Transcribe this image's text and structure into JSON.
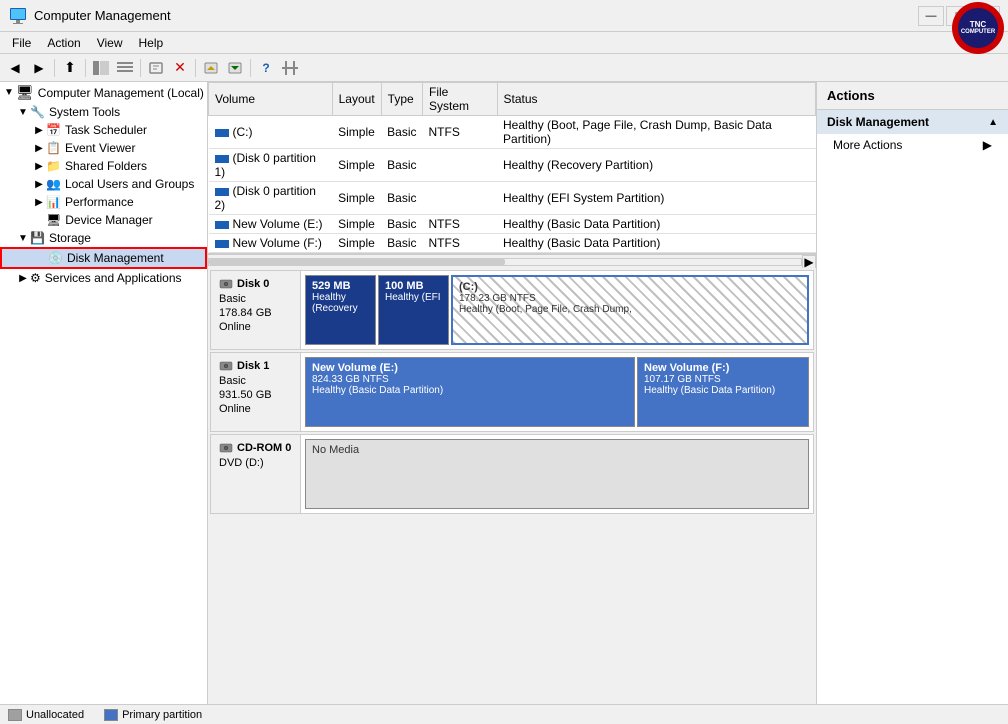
{
  "window": {
    "title": "Computer Management",
    "controls": {
      "minimize": "—",
      "maximize": "□",
      "close": "✕"
    }
  },
  "tnc": {
    "line1": "TNC",
    "line2": "COMPUTER"
  },
  "menubar": {
    "items": [
      "File",
      "Action",
      "View",
      "Help"
    ]
  },
  "toolbar": {
    "buttons": [
      "◀",
      "▶",
      "⬆",
      "🖥",
      "📄",
      "⬛",
      "📋",
      "🚫",
      "📤",
      "📥",
      "🔧"
    ]
  },
  "sidebar": {
    "root": {
      "label": "Computer Management (Local)",
      "children": [
        {
          "label": "System Tools",
          "expanded": true,
          "children": [
            {
              "label": "Task Scheduler"
            },
            {
              "label": "Event Viewer"
            },
            {
              "label": "Shared Folders"
            },
            {
              "label": "Local Users and Groups"
            },
            {
              "label": "Performance"
            },
            {
              "label": "Device Manager"
            }
          ]
        },
        {
          "label": "Storage",
          "expanded": true,
          "children": [
            {
              "label": "Disk Management",
              "selected": true
            }
          ]
        },
        {
          "label": "Services and Applications",
          "expanded": false,
          "children": []
        }
      ]
    }
  },
  "table": {
    "columns": [
      "Volume",
      "Layout",
      "Type",
      "File System",
      "Status"
    ],
    "rows": [
      {
        "volume": "(C:)",
        "layout": "Simple",
        "type": "Basic",
        "fs": "NTFS",
        "status": "Healthy (Boot, Page File, Crash Dump, Basic Data Partition)"
      },
      {
        "volume": "(Disk 0 partition 1)",
        "layout": "Simple",
        "type": "Basic",
        "fs": "",
        "status": "Healthy (Recovery Partition)"
      },
      {
        "volume": "(Disk 0 partition 2)",
        "layout": "Simple",
        "type": "Basic",
        "fs": "",
        "status": "Healthy (EFI System Partition)"
      },
      {
        "volume": "New Volume (E:)",
        "layout": "Simple",
        "type": "Basic",
        "fs": "NTFS",
        "status": "Healthy (Basic Data Partition)"
      },
      {
        "volume": "New Volume (F:)",
        "layout": "Simple",
        "type": "Basic",
        "fs": "NTFS",
        "status": "Healthy (Basic Data Partition)"
      }
    ]
  },
  "disks": [
    {
      "name": "Disk 0",
      "type": "Basic",
      "size": "178.84 GB",
      "status": "Online",
      "partitions": [
        {
          "label": "529 MB",
          "sublabel": "Healthy (Recovery",
          "style": "dark-blue",
          "flex": 1
        },
        {
          "label": "100 MB",
          "sublabel": "Healthy (EFI",
          "style": "dark-blue",
          "flex": 1
        },
        {
          "label": "(C:)",
          "sublabel2": "178.23 GB NTFS",
          "sublabel3": "Healthy (Boot, Page File, Crash Dump,",
          "style": "hatched",
          "flex": 6
        }
      ]
    },
    {
      "name": "Disk 1",
      "type": "Basic",
      "size": "931.50 GB",
      "status": "Online",
      "partitions": [
        {
          "label": "New Volume  (E:)",
          "sublabel2": "824.33 GB NTFS",
          "sublabel3": "Healthy (Basic Data Partition)",
          "style": "light-blue",
          "flex": 4
        },
        {
          "label": "New Volume  (F:)",
          "sublabel2": "107.17 GB NTFS",
          "sublabel3": "Healthy (Basic Data Partition)",
          "style": "light-blue",
          "flex": 2
        }
      ]
    },
    {
      "name": "CD-ROM 0",
      "type": "DVD (D:)",
      "size": "",
      "status": "",
      "partitions": [
        {
          "label": "No Media",
          "style": "empty",
          "flex": 1
        }
      ]
    }
  ],
  "actions": {
    "title": "Actions",
    "section": "Disk Management",
    "items": [
      {
        "label": "More Actions",
        "hasArrow": true
      }
    ]
  },
  "statusbar": {
    "legend": [
      {
        "type": "unalloc",
        "label": "Unallocated"
      },
      {
        "type": "primary",
        "label": "Primary partition"
      }
    ]
  }
}
